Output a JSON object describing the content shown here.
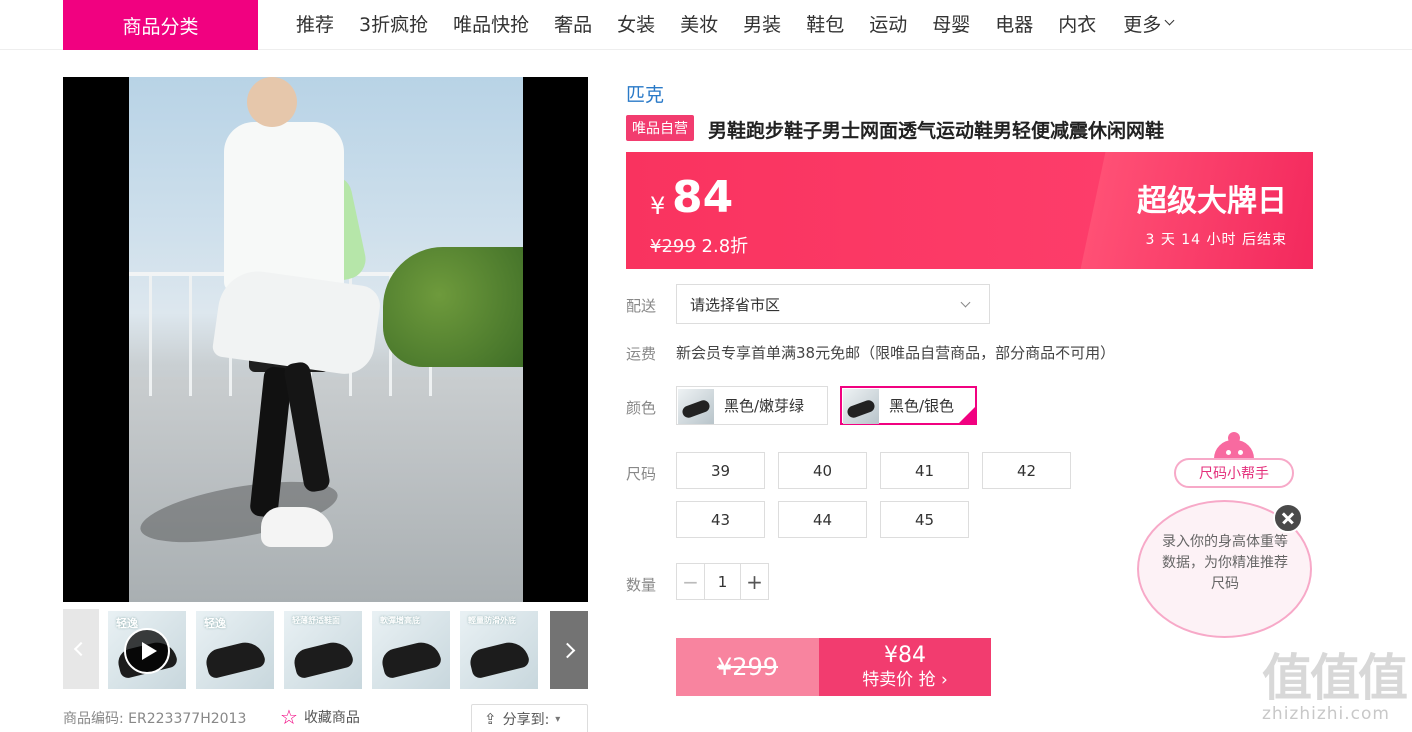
{
  "nav": {
    "category_button": "商品分类",
    "items": [
      "推荐",
      "3折疯抢",
      "唯品快抢",
      "奢品",
      "女装",
      "美妆",
      "男装",
      "鞋包",
      "运动",
      "母婴",
      "电器",
      "内衣"
    ],
    "more": "更多"
  },
  "gallery": {
    "thumbnails": [
      {
        "label": "轻逸",
        "has_play": true
      },
      {
        "label": "轻逸",
        "has_play": false
      },
      {
        "label": "轻薄舒适鞋面",
        "has_play": false
      },
      {
        "label": "軟彈增高底",
        "has_play": false
      },
      {
        "label": "輕量防滑外底",
        "has_play": false
      }
    ]
  },
  "product": {
    "code_label": "商品编码:",
    "code": "ER223377H2013",
    "favorite": "收藏商品",
    "share": "分享到:",
    "brand": "匹克",
    "self_tag": "唯品自营",
    "title": "男鞋跑步鞋子男士网面透气运动鞋男轻便减震休闲网鞋"
  },
  "price": {
    "currency": "¥",
    "current": "84",
    "original": "¥299",
    "discount": "2.8折",
    "event": "超级大牌日",
    "countdown": "3  天  14  小时  后结束"
  },
  "delivery": {
    "label": "配送",
    "placeholder": "请选择省市区"
  },
  "freight": {
    "label": "运费",
    "text": "新会员专享首单满38元免邮（限唯品自营商品，部分商品不可用）"
  },
  "colors": {
    "label": "颜色",
    "options": [
      {
        "name": "黑色/嫩芽绿",
        "selected": false
      },
      {
        "name": "黑色/银色",
        "selected": true
      }
    ]
  },
  "sizes": {
    "label": "尺码",
    "options": [
      "39",
      "40",
      "41",
      "42",
      "43",
      "44",
      "45"
    ]
  },
  "quantity": {
    "label": "数量",
    "value": "1",
    "minus": "−",
    "plus": "+"
  },
  "buy": {
    "original": "¥299",
    "price": "¥84",
    "action": "特卖价 抢 ›"
  },
  "size_helper": {
    "tag": "尺码小帮手",
    "text": "录入你的身高体重等数据，为你精准推荐尺码"
  },
  "watermark": {
    "glyphs": "值值值",
    "site": "zhizhizhi.com"
  },
  "colors_theme": {
    "accent": "#f10180",
    "price_red": "#f23c6f",
    "brand_blue": "#2a7ac8"
  }
}
